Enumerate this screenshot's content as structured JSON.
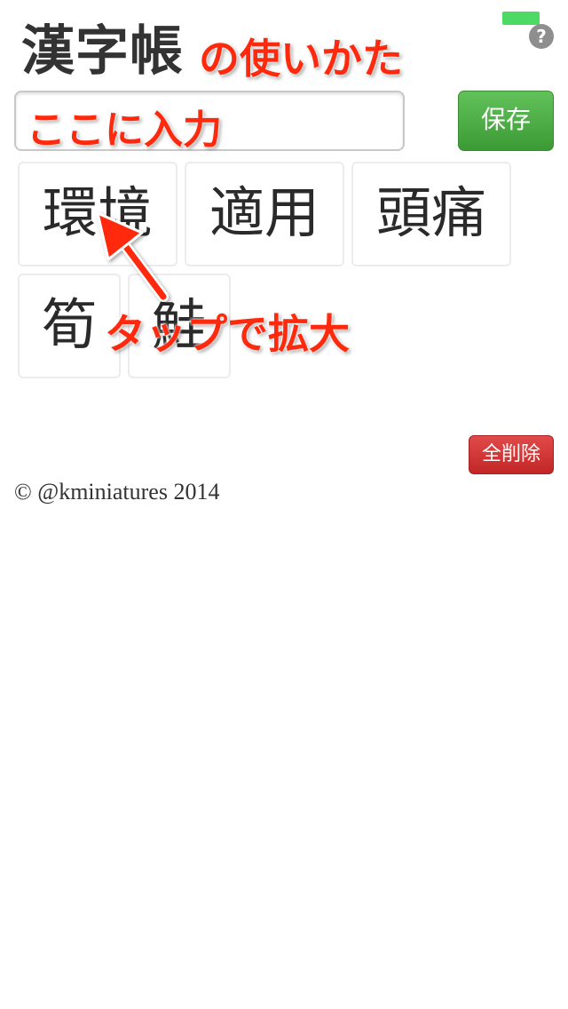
{
  "status_bar": {
    "battery_color": "#4cd964"
  },
  "header": {
    "app_title": "漢字帳",
    "help_icon_glyph": "?",
    "help_icon": "question-mark-icon"
  },
  "annotations": {
    "title_note": "の使いかた",
    "input_note": "ここに入力",
    "tap_note": "タップで拡大",
    "note_color": "#ff2a0d"
  },
  "input": {
    "value": "",
    "placeholder": ""
  },
  "buttons": {
    "save_label": "保存",
    "save_color": "#3c9a35",
    "delete_all_label": "全削除",
    "delete_all_color": "#c22626"
  },
  "kanji_cards": [
    "環境",
    "適用",
    "頭痛",
    "筍",
    "鮭"
  ],
  "footer": {
    "copyright": "© @kminiatures 2014"
  }
}
